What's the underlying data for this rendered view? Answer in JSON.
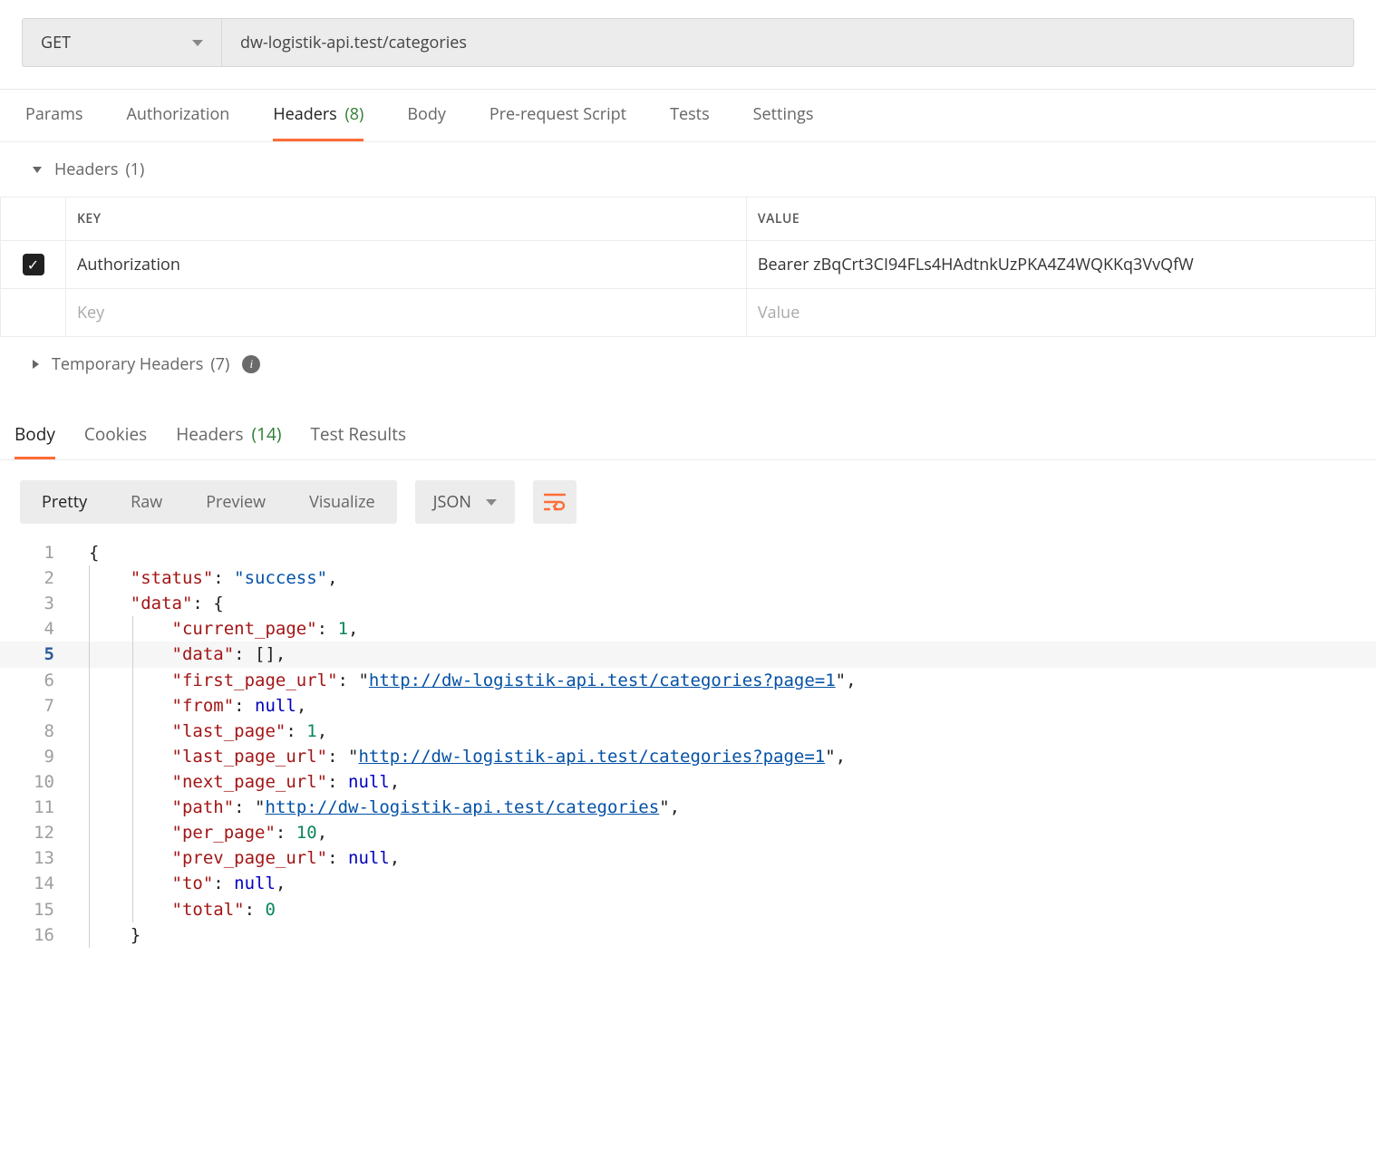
{
  "request": {
    "method": "GET",
    "url": "dw-logistik-api.test/categories"
  },
  "tabs": {
    "params": "Params",
    "authorization": "Authorization",
    "headers": "Headers",
    "headers_count": "(8)",
    "body": "Body",
    "prerequest": "Pre-request Script",
    "tests": "Tests",
    "settings": "Settings"
  },
  "headers_section": {
    "title": "Headers",
    "count": "(1)"
  },
  "header_table": {
    "col_key": "KEY",
    "col_value": "VALUE",
    "rows": [
      {
        "enabled": true,
        "key": "Authorization",
        "value": "Bearer zBqCrt3CI94FLs4HAdtnkUzPKA4Z4WQKKq3VvQfW"
      }
    ],
    "placeholder_key": "Key",
    "placeholder_value": "Value"
  },
  "temp_headers": {
    "label": "Temporary Headers",
    "count": "(7)"
  },
  "response_tabs": {
    "body": "Body",
    "cookies": "Cookies",
    "headers": "Headers",
    "headers_count": "(14)",
    "test_results": "Test Results"
  },
  "body_toolbar": {
    "pretty": "Pretty",
    "raw": "Raw",
    "preview": "Preview",
    "visualize": "Visualize",
    "format": "JSON"
  },
  "code": {
    "lines": [
      {
        "n": "1",
        "indent": 0,
        "tokens": [
          {
            "t": "punc",
            "v": "{"
          }
        ]
      },
      {
        "n": "2",
        "indent": 1,
        "tokens": [
          {
            "t": "key",
            "v": "\"status\""
          },
          {
            "t": "punc",
            "v": ": "
          },
          {
            "t": "str",
            "v": "\"success\""
          },
          {
            "t": "punc",
            "v": ","
          }
        ]
      },
      {
        "n": "3",
        "indent": 1,
        "tokens": [
          {
            "t": "key",
            "v": "\"data\""
          },
          {
            "t": "punc",
            "v": ": {"
          }
        ]
      },
      {
        "n": "4",
        "indent": 2,
        "tokens": [
          {
            "t": "key",
            "v": "\"current_page\""
          },
          {
            "t": "punc",
            "v": ": "
          },
          {
            "t": "num",
            "v": "1"
          },
          {
            "t": "punc",
            "v": ","
          }
        ]
      },
      {
        "n": "5",
        "indent": 2,
        "hl": true,
        "tokens": [
          {
            "t": "key",
            "v": "\"data\""
          },
          {
            "t": "punc",
            "v": ": []"
          },
          {
            "t": "punc",
            "v": ","
          }
        ]
      },
      {
        "n": "6",
        "indent": 2,
        "tokens": [
          {
            "t": "key",
            "v": "\"first_page_url\""
          },
          {
            "t": "punc",
            "v": ": "
          },
          {
            "t": "punc",
            "v": "\""
          },
          {
            "t": "link",
            "v": "http://dw-logistik-api.test/categories?page=1"
          },
          {
            "t": "punc",
            "v": "\""
          },
          {
            "t": "punc",
            "v": ","
          }
        ]
      },
      {
        "n": "7",
        "indent": 2,
        "tokens": [
          {
            "t": "key",
            "v": "\"from\""
          },
          {
            "t": "punc",
            "v": ": "
          },
          {
            "t": "null",
            "v": "null"
          },
          {
            "t": "punc",
            "v": ","
          }
        ]
      },
      {
        "n": "8",
        "indent": 2,
        "tokens": [
          {
            "t": "key",
            "v": "\"last_page\""
          },
          {
            "t": "punc",
            "v": ": "
          },
          {
            "t": "num",
            "v": "1"
          },
          {
            "t": "punc",
            "v": ","
          }
        ]
      },
      {
        "n": "9",
        "indent": 2,
        "tokens": [
          {
            "t": "key",
            "v": "\"last_page_url\""
          },
          {
            "t": "punc",
            "v": ": "
          },
          {
            "t": "punc",
            "v": "\""
          },
          {
            "t": "link",
            "v": "http://dw-logistik-api.test/categories?page=1"
          },
          {
            "t": "punc",
            "v": "\""
          },
          {
            "t": "punc",
            "v": ","
          }
        ]
      },
      {
        "n": "10",
        "indent": 2,
        "tokens": [
          {
            "t": "key",
            "v": "\"next_page_url\""
          },
          {
            "t": "punc",
            "v": ": "
          },
          {
            "t": "null",
            "v": "null"
          },
          {
            "t": "punc",
            "v": ","
          }
        ]
      },
      {
        "n": "11",
        "indent": 2,
        "tokens": [
          {
            "t": "key",
            "v": "\"path\""
          },
          {
            "t": "punc",
            "v": ": "
          },
          {
            "t": "punc",
            "v": "\""
          },
          {
            "t": "link",
            "v": "http://dw-logistik-api.test/categories"
          },
          {
            "t": "punc",
            "v": "\""
          },
          {
            "t": "punc",
            "v": ","
          }
        ]
      },
      {
        "n": "12",
        "indent": 2,
        "tokens": [
          {
            "t": "key",
            "v": "\"per_page\""
          },
          {
            "t": "punc",
            "v": ": "
          },
          {
            "t": "num",
            "v": "10"
          },
          {
            "t": "punc",
            "v": ","
          }
        ]
      },
      {
        "n": "13",
        "indent": 2,
        "tokens": [
          {
            "t": "key",
            "v": "\"prev_page_url\""
          },
          {
            "t": "punc",
            "v": ": "
          },
          {
            "t": "null",
            "v": "null"
          },
          {
            "t": "punc",
            "v": ","
          }
        ]
      },
      {
        "n": "14",
        "indent": 2,
        "tokens": [
          {
            "t": "key",
            "v": "\"to\""
          },
          {
            "t": "punc",
            "v": ": "
          },
          {
            "t": "null",
            "v": "null"
          },
          {
            "t": "punc",
            "v": ","
          }
        ]
      },
      {
        "n": "15",
        "indent": 2,
        "tokens": [
          {
            "t": "key",
            "v": "\"total\""
          },
          {
            "t": "punc",
            "v": ": "
          },
          {
            "t": "num",
            "v": "0"
          }
        ]
      },
      {
        "n": "16",
        "indent": 1,
        "tokens": [
          {
            "t": "punc",
            "v": "}"
          }
        ]
      }
    ]
  }
}
